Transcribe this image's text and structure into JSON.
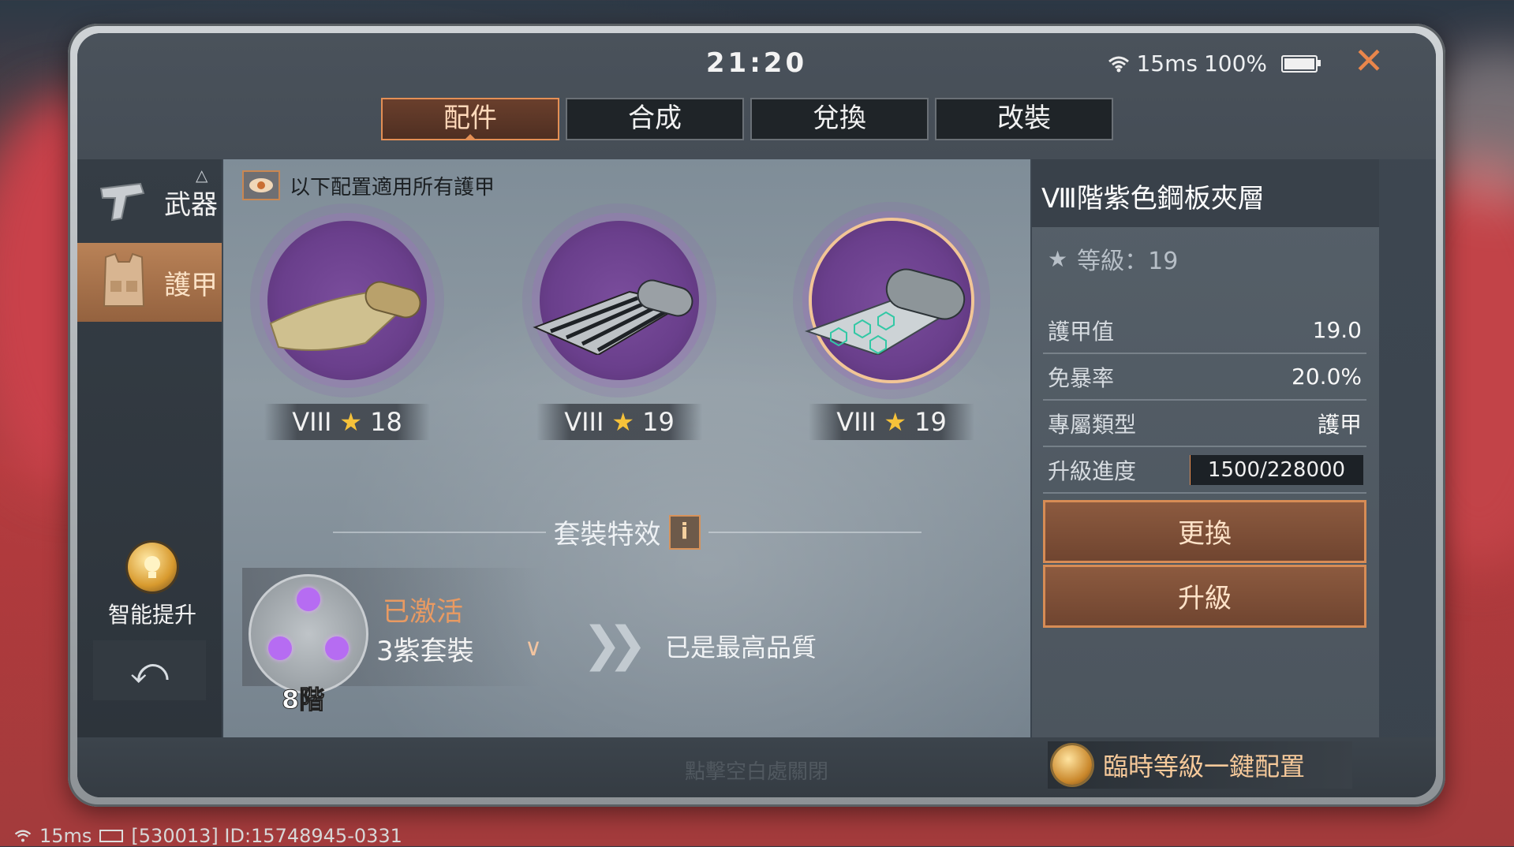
{
  "status": {
    "time": "21:20",
    "ping": "15ms",
    "battery": "100%"
  },
  "tabs": [
    {
      "label": "配件",
      "active": true
    },
    {
      "label": "合成",
      "active": false
    },
    {
      "label": "兌換",
      "active": false
    },
    {
      "label": "改裝",
      "active": false
    }
  ],
  "sidebar": {
    "items": [
      {
        "label": "武器",
        "icon": "pistol-icon"
      },
      {
        "label": "護甲",
        "icon": "armor-vest-icon",
        "active": true
      }
    ],
    "smart_label": "智能提升"
  },
  "main": {
    "note": "以下配置適用所有護甲",
    "parts": [
      {
        "tier": "VIII",
        "level": "18",
        "icon": "gold-fabric-roll-icon"
      },
      {
        "tier": "VIII",
        "level": "19",
        "icon": "steel-mesh-roll-icon"
      },
      {
        "tier": "VIII",
        "level": "19",
        "icon": "hex-plate-roll-icon",
        "selected": true
      }
    ],
    "set_title": "套裝特效",
    "info_label": "i",
    "set_status": "已激活",
    "set_name": "3紫套裝",
    "set_tier": "8階",
    "max_quality": "已是最高品質"
  },
  "detail": {
    "name": "Ⅷ階紫色鋼板夾層",
    "level": "等級：19",
    "stats": [
      {
        "key": "護甲值",
        "value": "19.0"
      },
      {
        "key": "免暴率",
        "value": "20.0%"
      },
      {
        "key": "專屬類型",
        "value": "護甲"
      }
    ],
    "progress_label": "升級進度",
    "progress_text": "1500/228000",
    "progress_fraction": 0.0066,
    "replace_label": "更換",
    "upgrade_label": "升級"
  },
  "bottom": {
    "hint": "點擊空白處關閉",
    "quick_config": "臨時等級一鍵配置"
  },
  "footer": {
    "ping": "15ms",
    "id": "[530013] ID:15748945-0331"
  },
  "colors": {
    "accent": "#e48f55",
    "purple": "#7a4d9c",
    "close": "#e9864b"
  }
}
